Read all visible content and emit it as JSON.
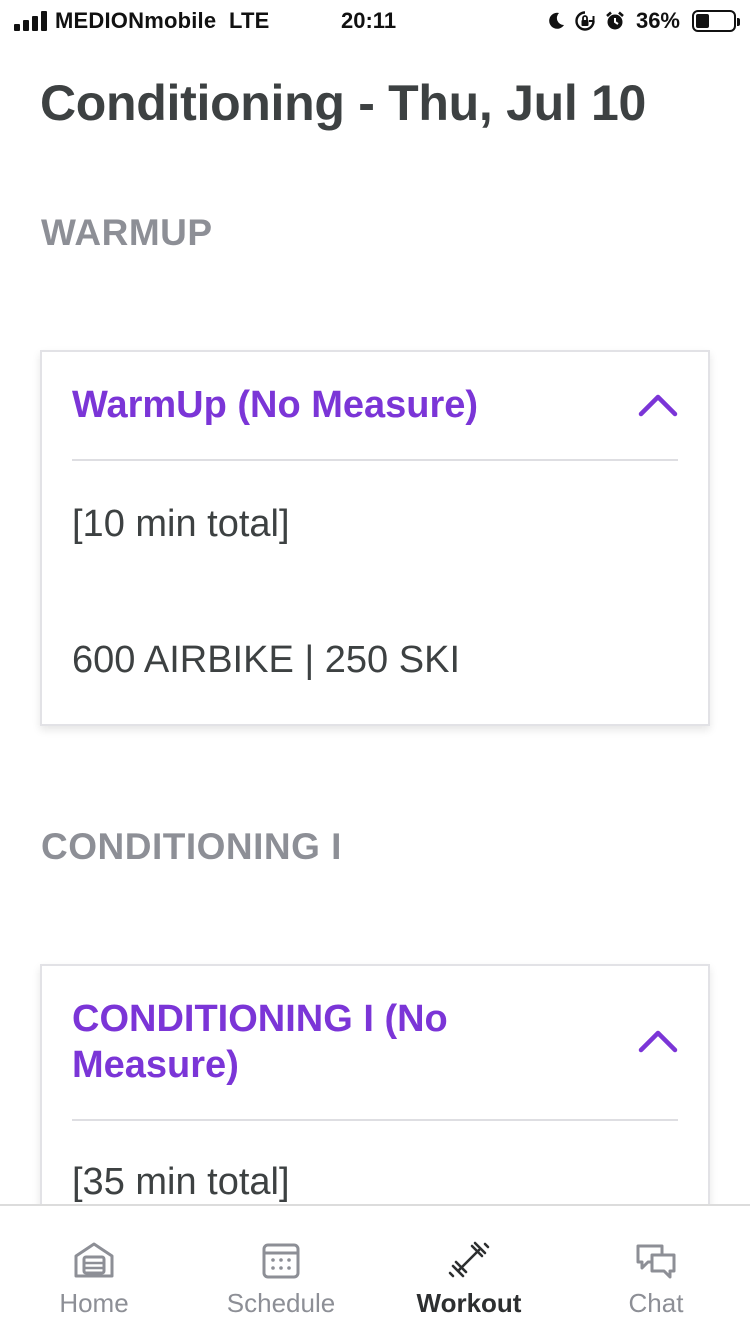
{
  "status_bar": {
    "carrier": "MEDIONmobile",
    "network": "LTE",
    "time": "20:11",
    "battery_percent": "36%",
    "battery_level": 0.36,
    "icons": [
      "moon-icon",
      "orientation-lock-icon",
      "alarm-icon",
      "battery-icon"
    ]
  },
  "page": {
    "title": "Conditioning - Thu, Jul 10"
  },
  "sections": [
    {
      "header": "WARMUP",
      "card": {
        "title": "WarmUp (No Measure)",
        "lines": [
          "[10 min total]",
          "600 AIRBIKE | 250 SKI"
        ]
      }
    },
    {
      "header": "CONDITIONING I",
      "card": {
        "title_line1": "CONDITIONING I (No",
        "title_line2": "Measure)",
        "lines": [
          "[35 min total]"
        ]
      }
    }
  ],
  "tab_bar": {
    "tabs": [
      {
        "label": "Home",
        "icon": "home-icon",
        "active": false
      },
      {
        "label": "Schedule",
        "icon": "calendar-icon",
        "active": false
      },
      {
        "label": "Workout",
        "icon": "dumbbell-icon",
        "active": true
      },
      {
        "label": "Chat",
        "icon": "chat-icon",
        "active": false
      }
    ]
  },
  "colors": {
    "accent": "#7b35d7",
    "title_text": "#3d4142",
    "section_header": "#8d8f96",
    "tab_inactive": "#8d8f96"
  }
}
